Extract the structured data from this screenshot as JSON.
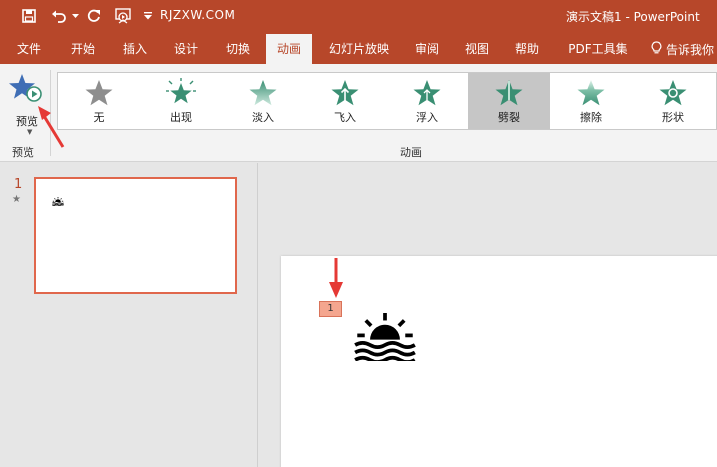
{
  "titlebar": {
    "url": "RJZXW.COM",
    "title": "演示文稿1  -  PowerPoint"
  },
  "tabs": [
    {
      "id": "file",
      "label": "文件"
    },
    {
      "id": "home",
      "label": "开始"
    },
    {
      "id": "insert",
      "label": "插入"
    },
    {
      "id": "design",
      "label": "设计"
    },
    {
      "id": "transitions",
      "label": "切换"
    },
    {
      "id": "animations",
      "label": "动画",
      "active": true
    },
    {
      "id": "slideshow",
      "label": "幻灯片放映"
    },
    {
      "id": "review",
      "label": "审阅"
    },
    {
      "id": "view",
      "label": "视图"
    },
    {
      "id": "help",
      "label": "帮助"
    },
    {
      "id": "pdf",
      "label": "PDF工具集"
    }
  ],
  "tell_me": "告诉我你",
  "ribbon": {
    "preview_label": "预览",
    "preview_group": "预览",
    "animation_group": "动画",
    "animations": [
      {
        "label": "无",
        "color": "#8e8e8e"
      },
      {
        "label": "出现",
        "color": "#3a8f73"
      },
      {
        "label": "淡入",
        "color": "#7fc0a8"
      },
      {
        "label": "飞入",
        "color": "#3a8f73"
      },
      {
        "label": "浮入",
        "color": "#3a8f73"
      },
      {
        "label": "劈裂",
        "color": "#3a8f73",
        "selected": true
      },
      {
        "label": "擦除",
        "color": "#5fb095"
      },
      {
        "label": "形状",
        "color": "#3a8f73"
      }
    ]
  },
  "slides_panel": {
    "slide_number": "1",
    "has_animation_marker": "★"
  },
  "slide": {
    "animation_order_tag": "1"
  },
  "colors": {
    "accent": "#b7472a",
    "annotation_red": "#e53935"
  }
}
